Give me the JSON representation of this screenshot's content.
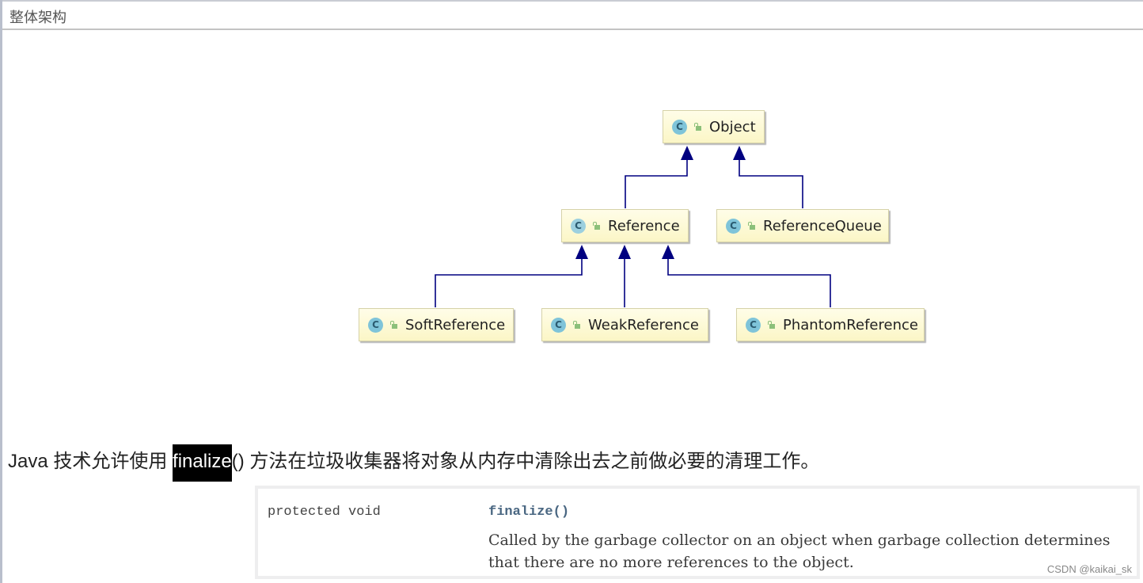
{
  "header": {
    "title": "整体架构"
  },
  "diagram": {
    "edge_color": "#000080",
    "node_fill": "#fbf6c6",
    "nodes": [
      {
        "id": "Object",
        "label": "Object",
        "icon": "class-icon",
        "abstract": false
      },
      {
        "id": "Reference",
        "label": "Reference",
        "icon": "abstract-class-icon",
        "abstract": true
      },
      {
        "id": "ReferenceQueue",
        "label": "ReferenceQueue",
        "icon": "class-icon",
        "abstract": false
      },
      {
        "id": "SoftReference",
        "label": "SoftReference",
        "icon": "class-icon",
        "abstract": false
      },
      {
        "id": "WeakReference",
        "label": "WeakReference",
        "icon": "class-icon",
        "abstract": false
      },
      {
        "id": "PhantomReference",
        "label": "PhantomReference",
        "icon": "class-icon",
        "abstract": false
      }
    ],
    "edges": [
      {
        "from": "Reference",
        "to": "Object",
        "type": "extends"
      },
      {
        "from": "ReferenceQueue",
        "to": "Object",
        "type": "extends"
      },
      {
        "from": "SoftReference",
        "to": "Reference",
        "type": "extends"
      },
      {
        "from": "WeakReference",
        "to": "Reference",
        "type": "extends"
      },
      {
        "from": "PhantomReference",
        "to": "Reference",
        "type": "extends"
      }
    ],
    "class_icon_letter": "C"
  },
  "intro": {
    "prefix": "Java 技术允许使用 ",
    "highlight": "finalize",
    "suffix": "() 方法在垃圾收集器将对象从内存中清除出去之前做必要的清理工作。"
  },
  "api": {
    "modifier": "protected void",
    "method": "finalize()",
    "description": "Called by the garbage collector on an object when garbage collection determines that there are no more references to the object."
  },
  "watermark": "CSDN @kaikai_sk"
}
